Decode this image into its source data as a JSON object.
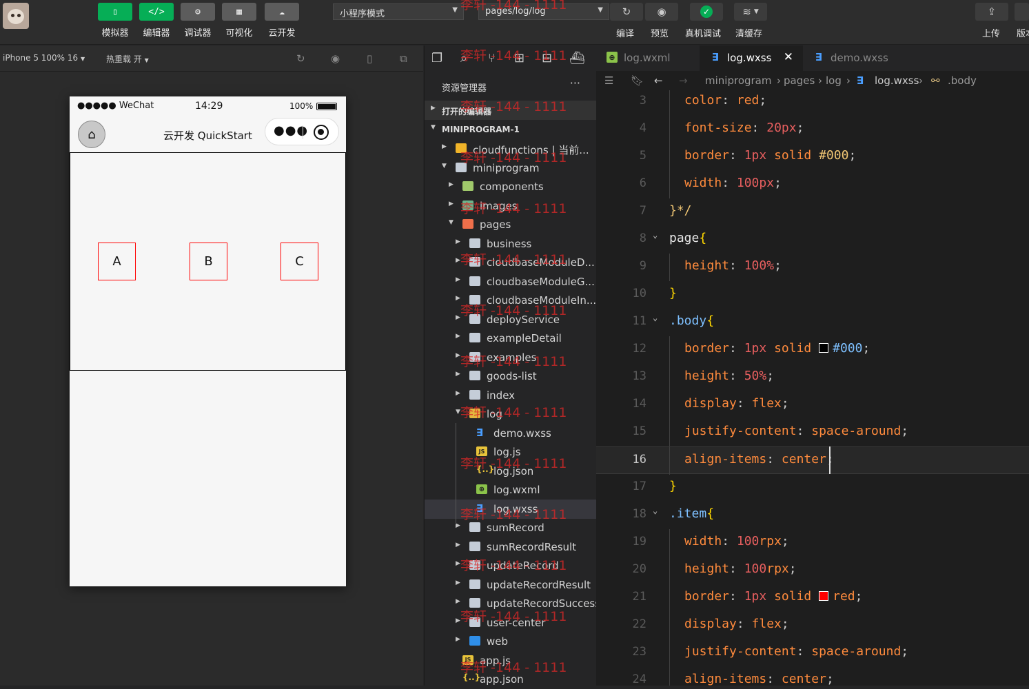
{
  "toolbar": {
    "left_buttons": [
      {
        "label": "模拟器",
        "icon": "phone-icon",
        "glyph": "▯"
      },
      {
        "label": "编辑器",
        "icon": "code-icon",
        "glyph": "</>"
      },
      {
        "label": "调试器",
        "icon": "debug-icon",
        "glyph": "⚙"
      },
      {
        "label": "可视化",
        "icon": "layout-icon",
        "glyph": "▦"
      },
      {
        "label": "云开发",
        "icon": "cloud-icon",
        "glyph": "☁"
      }
    ],
    "mode_select": "小程序模式",
    "page_select": "pages/log/log",
    "right_buttons": [
      {
        "label": "编译",
        "icon": "refresh-icon",
        "glyph": "↻"
      },
      {
        "label": "预览",
        "icon": "eye-icon",
        "glyph": "◉"
      },
      {
        "label": "真机调试",
        "icon": "check-icon",
        "glyph": "✓"
      },
      {
        "label": "清缓存",
        "icon": "layers-icon",
        "glyph": "≋"
      },
      {
        "label": "上传",
        "icon": "upload-icon",
        "glyph": "⇪"
      },
      {
        "label": "版本",
        "icon": "version-icon"
      }
    ]
  },
  "simulator": {
    "device": "iPhone 5 100% 16",
    "hot_reload": "热重载 开",
    "status": {
      "carrier": "●●●●● WeChat",
      "time": "14:29",
      "battery": "100%"
    },
    "nav_title": "云开发 QuickStart",
    "items": [
      "A",
      "B",
      "C"
    ]
  },
  "explorer": {
    "header": "资源管理器",
    "open_editors": "打开的编辑器",
    "project": "MINIPROGRAM-1",
    "tree": [
      {
        "name": "cloudfunctions | 当前...",
        "type": "folder-cloud",
        "depth": 0,
        "open": false
      },
      {
        "name": "miniprogram",
        "type": "folder",
        "depth": 0,
        "open": true
      },
      {
        "name": "components",
        "type": "folder-comp",
        "depth": 1,
        "open": false
      },
      {
        "name": "images",
        "type": "folder-img",
        "depth": 1,
        "open": false
      },
      {
        "name": "pages",
        "type": "folder-pages",
        "depth": 1,
        "open": true
      },
      {
        "name": "business",
        "type": "folder",
        "depth": 2,
        "open": false
      },
      {
        "name": "cloudbaseModuleD...",
        "type": "folder",
        "depth": 2,
        "open": false
      },
      {
        "name": "cloudbaseModuleG...",
        "type": "folder",
        "depth": 2,
        "open": false
      },
      {
        "name": "cloudbaseModuleIn...",
        "type": "folder",
        "depth": 2,
        "open": false
      },
      {
        "name": "deployService",
        "type": "folder",
        "depth": 2,
        "open": false
      },
      {
        "name": "exampleDetail",
        "type": "folder",
        "depth": 2,
        "open": false
      },
      {
        "name": "examples",
        "type": "folder",
        "depth": 2,
        "open": false
      },
      {
        "name": "goods-list",
        "type": "folder",
        "depth": 2,
        "open": false
      },
      {
        "name": "index",
        "type": "folder",
        "depth": 2,
        "open": false
      },
      {
        "name": "log",
        "type": "folder-log",
        "depth": 2,
        "open": true
      },
      {
        "name": "demo.wxss",
        "type": "wxss",
        "depth": 3
      },
      {
        "name": "log.js",
        "type": "js",
        "depth": 3
      },
      {
        "name": "log.json",
        "type": "json",
        "depth": 3
      },
      {
        "name": "log.wxml",
        "type": "wxml",
        "depth": 3
      },
      {
        "name": "log.wxss",
        "type": "wxss",
        "depth": 3,
        "active": true
      },
      {
        "name": "sumRecord",
        "type": "folder",
        "depth": 2,
        "open": false
      },
      {
        "name": "sumRecordResult",
        "type": "folder",
        "depth": 2,
        "open": false
      },
      {
        "name": "updateRecord",
        "type": "folder",
        "depth": 2,
        "open": false
      },
      {
        "name": "updateRecordResult",
        "type": "folder",
        "depth": 2,
        "open": false
      },
      {
        "name": "updateRecordSuccess",
        "type": "folder",
        "depth": 2,
        "open": false
      },
      {
        "name": "user-center",
        "type": "folder",
        "depth": 2,
        "open": false
      },
      {
        "name": "web",
        "type": "folder-web",
        "depth": 2,
        "open": false
      },
      {
        "name": "app.js",
        "type": "js",
        "depth": 1
      },
      {
        "name": "app.json",
        "type": "json",
        "depth": 1
      }
    ]
  },
  "tabs": [
    {
      "name": "log.wxml",
      "type": "wxml"
    },
    {
      "name": "log.wxss",
      "type": "wxss",
      "active": true
    },
    {
      "name": "demo.wxss",
      "type": "wxss"
    }
  ],
  "breadcrumb": [
    "miniprogram",
    "pages",
    "log",
    "log.wxss",
    ".body"
  ],
  "code": [
    {
      "n": 3,
      "t": [
        [
          "p",
          "color"
        ],
        [
          "s",
          ": "
        ],
        [
          "v",
          "red"
        ],
        [
          "s",
          ";"
        ]
      ],
      "ind": 1
    },
    {
      "n": 4,
      "t": [
        [
          "p",
          "font-size"
        ],
        [
          "s",
          ": "
        ],
        [
          "n",
          "20px"
        ],
        [
          "s",
          ";"
        ]
      ],
      "ind": 1
    },
    {
      "n": 5,
      "t": [
        [
          "p",
          "border"
        ],
        [
          "s",
          ": "
        ],
        [
          "n",
          "1px"
        ],
        [
          "s",
          " "
        ],
        [
          "v",
          "solid"
        ],
        [
          "s",
          " "
        ],
        [
          "sl",
          "#000"
        ],
        [
          "s",
          ";"
        ]
      ],
      "ind": 1
    },
    {
      "n": 6,
      "t": [
        [
          "p",
          "width"
        ],
        [
          "s",
          ": "
        ],
        [
          "n",
          "100px"
        ],
        [
          "s",
          ";"
        ]
      ],
      "ind": 1
    },
    {
      "n": 7,
      "t": [
        [
          "sl",
          "}*/"
        ]
      ],
      "ind": 0
    },
    {
      "n": 8,
      "t": [
        [
          "kw",
          "page"
        ],
        [
          "b",
          "{"
        ]
      ],
      "ind": 0,
      "fold": true
    },
    {
      "n": 9,
      "t": [
        [
          "p",
          "height"
        ],
        [
          "s",
          ": "
        ],
        [
          "n",
          "100%"
        ],
        [
          "s",
          ";"
        ]
      ],
      "ind": 1
    },
    {
      "n": 10,
      "t": [
        [
          "b",
          "}"
        ]
      ],
      "ind": 0
    },
    {
      "n": 11,
      "t": [
        [
          "h",
          ".body"
        ],
        [
          "b",
          "{"
        ]
      ],
      "ind": 0,
      "fold": true
    },
    {
      "n": 12,
      "t": [
        [
          "p",
          "border"
        ],
        [
          "s",
          ": "
        ],
        [
          "n",
          "1px"
        ],
        [
          "s",
          " "
        ],
        [
          "v",
          "solid"
        ],
        [
          "s",
          " "
        ],
        [
          "sw",
          "#000"
        ],
        [
          "h",
          "#000"
        ],
        [
          "s",
          ";"
        ]
      ],
      "ind": 1
    },
    {
      "n": 13,
      "t": [
        [
          "p",
          "height"
        ],
        [
          "s",
          ": "
        ],
        [
          "n",
          "50%"
        ],
        [
          "s",
          ";"
        ]
      ],
      "ind": 1
    },
    {
      "n": 14,
      "t": [
        [
          "p",
          "display"
        ],
        [
          "s",
          ": "
        ],
        [
          "v",
          "flex"
        ],
        [
          "s",
          ";"
        ]
      ],
      "ind": 1
    },
    {
      "n": 15,
      "t": [
        [
          "p",
          "justify-content"
        ],
        [
          "s",
          ": "
        ],
        [
          "v",
          "space-around"
        ],
        [
          "s",
          ";"
        ]
      ],
      "ind": 1
    },
    {
      "n": 16,
      "t": [
        [
          "p",
          "align-items"
        ],
        [
          "s",
          ": "
        ],
        [
          "v",
          "center"
        ],
        [
          "s",
          ";"
        ]
      ],
      "ind": 1,
      "cur": true
    },
    {
      "n": 17,
      "t": [
        [
          "b",
          "}"
        ]
      ],
      "ind": 0
    },
    {
      "n": 18,
      "t": [
        [
          "h",
          ".item"
        ],
        [
          "b",
          "{"
        ]
      ],
      "ind": 0,
      "fold": true
    },
    {
      "n": 19,
      "t": [
        [
          "p",
          "width"
        ],
        [
          "s",
          ": "
        ],
        [
          "n",
          "100"
        ],
        [
          "v",
          "rpx"
        ],
        [
          "s",
          ";"
        ]
      ],
      "ind": 1
    },
    {
      "n": 20,
      "t": [
        [
          "p",
          "height"
        ],
        [
          "s",
          ": "
        ],
        [
          "n",
          "100"
        ],
        [
          "v",
          "rpx"
        ],
        [
          "s",
          ";"
        ]
      ],
      "ind": 1
    },
    {
      "n": 21,
      "t": [
        [
          "p",
          "border"
        ],
        [
          "s",
          ": "
        ],
        [
          "n",
          "1px"
        ],
        [
          "s",
          " "
        ],
        [
          "v",
          "solid"
        ],
        [
          "s",
          " "
        ],
        [
          "sw",
          "red"
        ],
        [
          "v",
          "red"
        ],
        [
          "s",
          ";"
        ]
      ],
      "ind": 1
    },
    {
      "n": 22,
      "t": [
        [
          "p",
          "display"
        ],
        [
          "s",
          ": "
        ],
        [
          "v",
          "flex"
        ],
        [
          "s",
          ";"
        ]
      ],
      "ind": 1
    },
    {
      "n": 23,
      "t": [
        [
          "p",
          "justify-content"
        ],
        [
          "s",
          ": "
        ],
        [
          "v",
          "space-around"
        ],
        [
          "s",
          ";"
        ]
      ],
      "ind": 1
    },
    {
      "n": 24,
      "t": [
        [
          "p",
          "align-items"
        ],
        [
          "s",
          ": "
        ],
        [
          "v",
          "center"
        ],
        [
          "s",
          ";"
        ]
      ],
      "ind": 1
    }
  ],
  "watermark": "李轩 -144 - 1111",
  "colors": {
    "accent_green": "#06ae56",
    "item_border": "#ff0000",
    "wxss_icon": "#4a9eff"
  }
}
